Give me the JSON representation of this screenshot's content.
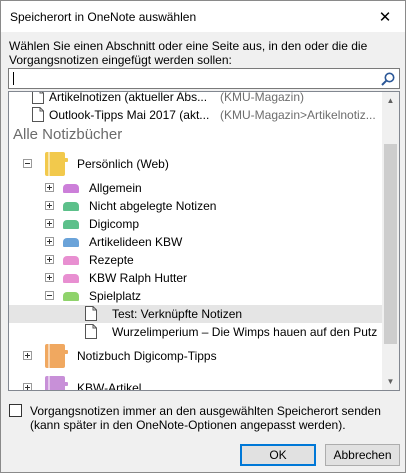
{
  "window": {
    "title": "Speicherort in OneNote auswählen",
    "close_glyph": "✕"
  },
  "instructions": "Wählen Sie einen Abschnitt oder eine Seite aus, in den oder die die Vorgangsnotizen eingefügt werden sollen:",
  "search": {
    "value": "",
    "icon": "search-icon"
  },
  "recent": [
    {
      "label": "Artikelnotizen (aktueller Abs...",
      "location": "(KMU-Magazin)"
    },
    {
      "label": "Outlook-Tipps Mai 2017 (akt...",
      "location": "(KMU-Magazin>Artikelnotiz..."
    }
  ],
  "all_notebooks_header": "Alle Notizbücher",
  "notebooks": [
    {
      "label": "Persönlich (Web)",
      "color": "#f2c94c",
      "expanded": true,
      "sections": [
        {
          "label": "Allgemein",
          "color": "#cc7fd9",
          "expanded": false
        },
        {
          "label": "Nicht abgelegte Notizen",
          "color": "#5cc08a",
          "expanded": false
        },
        {
          "label": "Digicomp",
          "color": "#5cc08a",
          "expanded": false
        },
        {
          "label": "Artikelideen KBW",
          "color": "#6aa3d9",
          "expanded": false
        },
        {
          "label": "Rezepte",
          "color": "#e88fd1",
          "expanded": false
        },
        {
          "label": "KBW Ralph Hutter",
          "color": "#e88fd1",
          "expanded": false
        },
        {
          "label": "Spielplatz",
          "color": "#8fd36b",
          "expanded": true,
          "pages": [
            {
              "label": "Test: Verknüpfte Notizen",
              "selected": true
            },
            {
              "label": "Wurzelimperium –  Die Wimps hauen auf den Putz",
              "selected": false
            }
          ]
        }
      ]
    },
    {
      "label": "Notizbuch Digicomp-Tipps",
      "color": "#f0a860",
      "expanded": false
    },
    {
      "label": "KBW-Artikel",
      "color": "#c890d8",
      "expanded": false
    }
  ],
  "checkbox": {
    "checked": false,
    "label_line1": "Vorgangsnotizen immer an den ausgewählten Speicherort senden",
    "label_line2": "(kann später in den OneNote-Optionen angepasst werden)."
  },
  "buttons": {
    "ok": "OK",
    "cancel": "Abbrechen"
  }
}
